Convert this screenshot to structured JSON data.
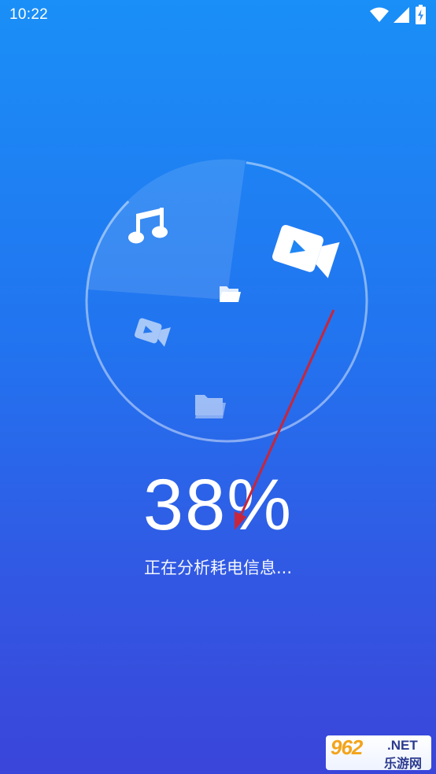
{
  "status_bar": {
    "time": "10:22",
    "icons": [
      "wifi-icon",
      "signal-icon",
      "battery-charging-icon"
    ]
  },
  "scan": {
    "progress_percent": 38,
    "percent_text": "38%",
    "message": "正在分析耗电信息...",
    "icons": [
      "music-icon",
      "video-icon",
      "folder-icon",
      "video-icon",
      "folder-icon"
    ]
  },
  "watermark": {
    "logo": "962",
    "suffix": ".NET",
    "site": "乐游网"
  },
  "colors": {
    "background_top": "#1a8ff7",
    "background_bottom": "#3a45d9",
    "arrow": "#c8253a",
    "watermark_logo": "#f3a41a"
  }
}
